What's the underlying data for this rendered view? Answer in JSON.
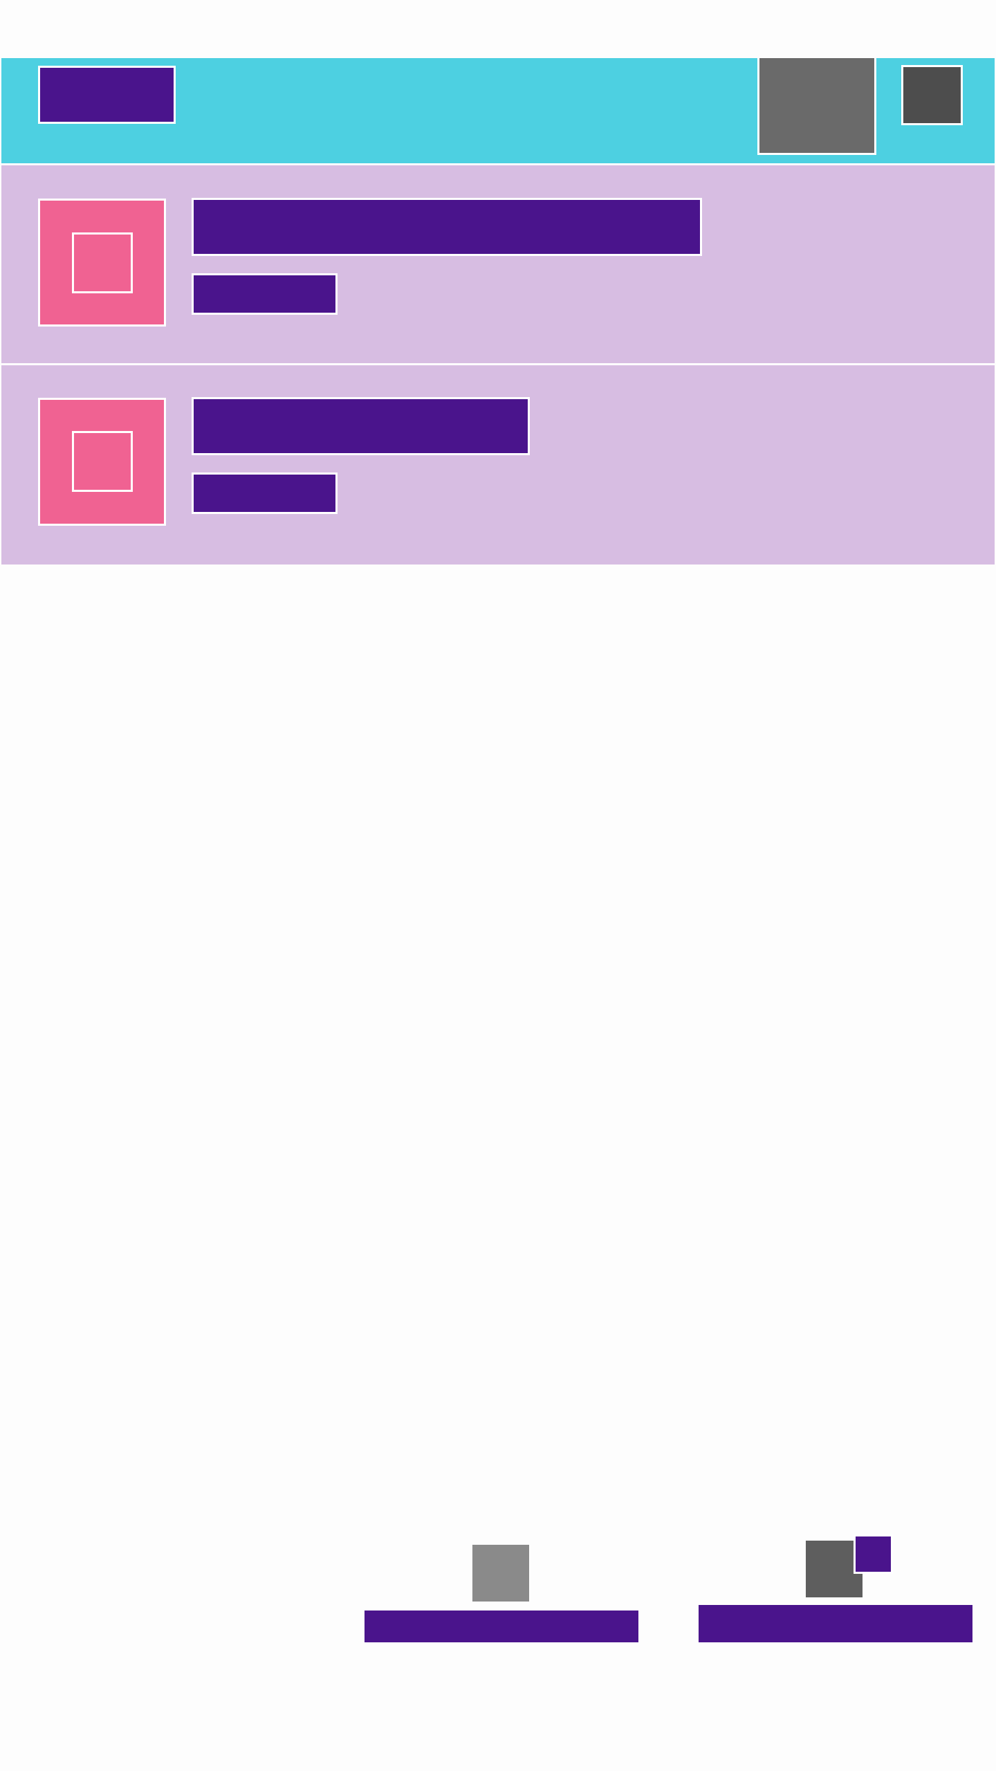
{
  "app_bar": {
    "title": "",
    "action_1_icon": "action-icon",
    "action_2_icon": "overflow-menu-icon"
  },
  "list": {
    "items": [
      {
        "thumbnail_icon": "image-icon",
        "title": "",
        "subtitle": ""
      },
      {
        "thumbnail_icon": "image-icon",
        "title": "",
        "subtitle": ""
      }
    ]
  },
  "bottom_nav": {
    "items": [
      {
        "icon": "nav-icon",
        "label": ""
      },
      {
        "icon": "nav-icon",
        "label": "",
        "badge": ""
      }
    ]
  },
  "colors": {
    "app_bar": "#4dd0e1",
    "list_row": "#d7bde2",
    "thumbnail": "#f06292",
    "accent": "#4a148c",
    "background": "#fdfdfd"
  }
}
